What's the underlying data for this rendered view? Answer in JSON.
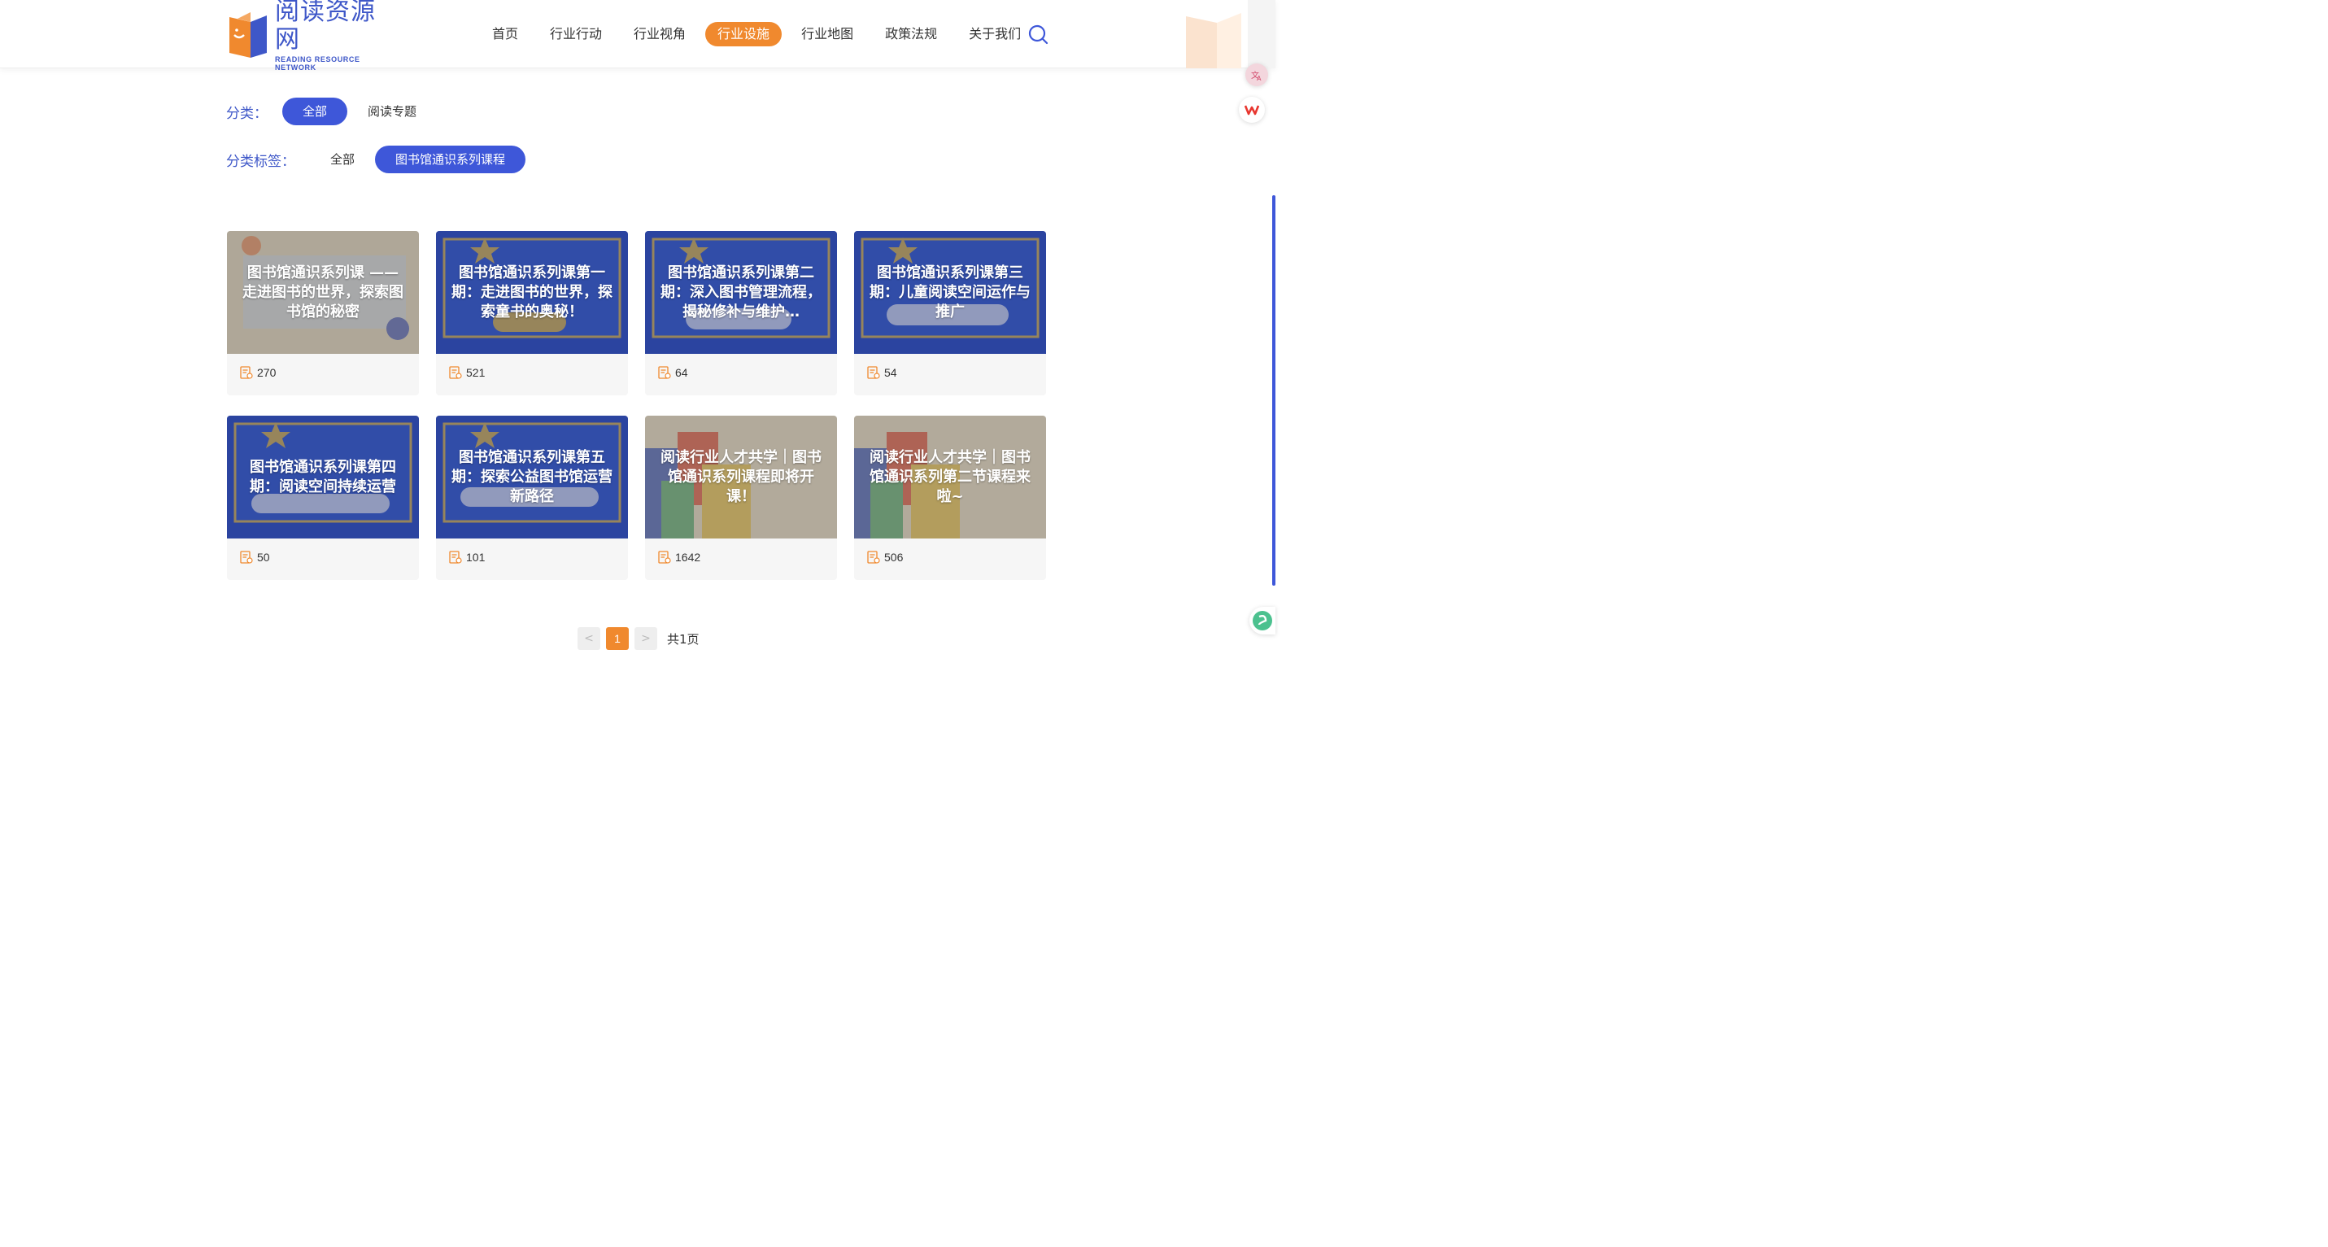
{
  "brand": {
    "name_cn": "阅读资源网",
    "name_en": "READING RESOURCE NETWORK"
  },
  "nav": {
    "items": [
      {
        "label": "首页",
        "active": false
      },
      {
        "label": "行业行动",
        "active": false
      },
      {
        "label": "行业视角",
        "active": false
      },
      {
        "label": "行业设施",
        "active": true
      },
      {
        "label": "行业地图",
        "active": false
      },
      {
        "label": "政策法规",
        "active": false
      },
      {
        "label": "关于我们",
        "active": false
      }
    ],
    "search_icon": "search-icon"
  },
  "filters": {
    "category": {
      "label": "分类：",
      "options": [
        "全部",
        "阅读专题"
      ],
      "selected": "全部"
    },
    "tag": {
      "label": "分类标签：",
      "options": [
        "全部",
        "图书馆通识系列课程"
      ],
      "selected": "图书馆通识系列课程"
    }
  },
  "cards": [
    {
      "title": "图书馆通识系列课 —— 走进图书的世界，探索图书馆的秘密",
      "count": "270"
    },
    {
      "title": "图书馆通识系列课第一期：走进图书的世界，探索童书的奥秘！",
      "count": "521"
    },
    {
      "title": "图书馆通识系列课第二期：深入图书管理流程，揭秘修补与维护…",
      "count": "64"
    },
    {
      "title": "图书馆通识系列课第三期：儿童阅读空间运作与推广",
      "count": "54"
    },
    {
      "title": "图书馆通识系列课第四期：阅读空间持续运营",
      "count": "50"
    },
    {
      "title": "图书馆通识系列课第五期：探索公益图书馆运营新路径",
      "count": "101"
    },
    {
      "title": "阅读行业人才共学｜图书馆通识系列课程即将开课！",
      "count": "1642"
    },
    {
      "title": "阅读行业人才共学｜图书馆通识系列第二节课程来啦~",
      "count": "506"
    }
  ],
  "pagination": {
    "prev": "<",
    "current": "1",
    "next": ">",
    "total": "共1页"
  },
  "colors": {
    "brand_blue": "#3e57d9",
    "accent_orange": "#f0892e",
    "logo_blue": "#3e57c8"
  }
}
